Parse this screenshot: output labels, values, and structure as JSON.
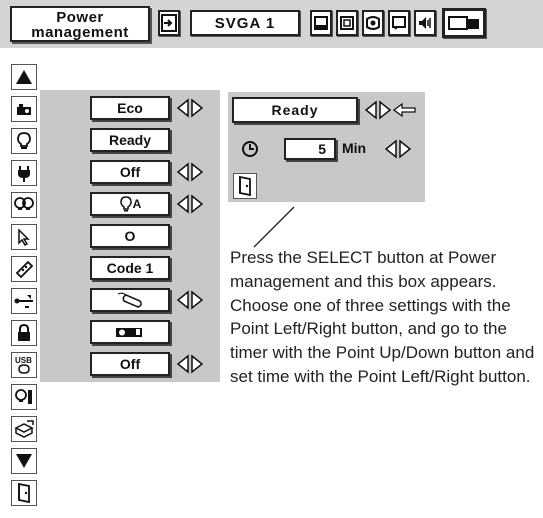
{
  "topbar": {
    "title": "Power\nmanagement",
    "title_line1": "Power",
    "title_line2": "management",
    "input_source": "SVGA 1"
  },
  "menu": {
    "items": [
      {
        "icon": "image-adjust-icon",
        "value": "Eco",
        "has_lr": true
      },
      {
        "icon": "lamp-icon",
        "value": "Ready",
        "has_lr": false
      },
      {
        "icon": "power-plug-icon",
        "value": "Off",
        "has_lr": true
      },
      {
        "icon": "lamp-mode-icon",
        "value": "A",
        "has_lr": true
      },
      {
        "icon": "pointer-icon",
        "value": "O",
        "has_lr": false
      },
      {
        "icon": "remote-code-icon",
        "value": "Code 1",
        "has_lr": false
      },
      {
        "icon": "network-icon",
        "value": "",
        "has_lr": true
      },
      {
        "icon": "lock-icon",
        "value": "",
        "has_lr": false
      },
      {
        "icon": "usb-icon",
        "value": "Off",
        "has_lr": true
      }
    ]
  },
  "popup": {
    "mode": "Ready",
    "timer_value": "5",
    "timer_unit": "Min"
  },
  "caption": "Press the SELECT button at Power management and this box appears.  Choose one of three settings with the Point Left/Right button, and go to the timer with the Point Up/Down button and set time with the Point Left/Right button."
}
